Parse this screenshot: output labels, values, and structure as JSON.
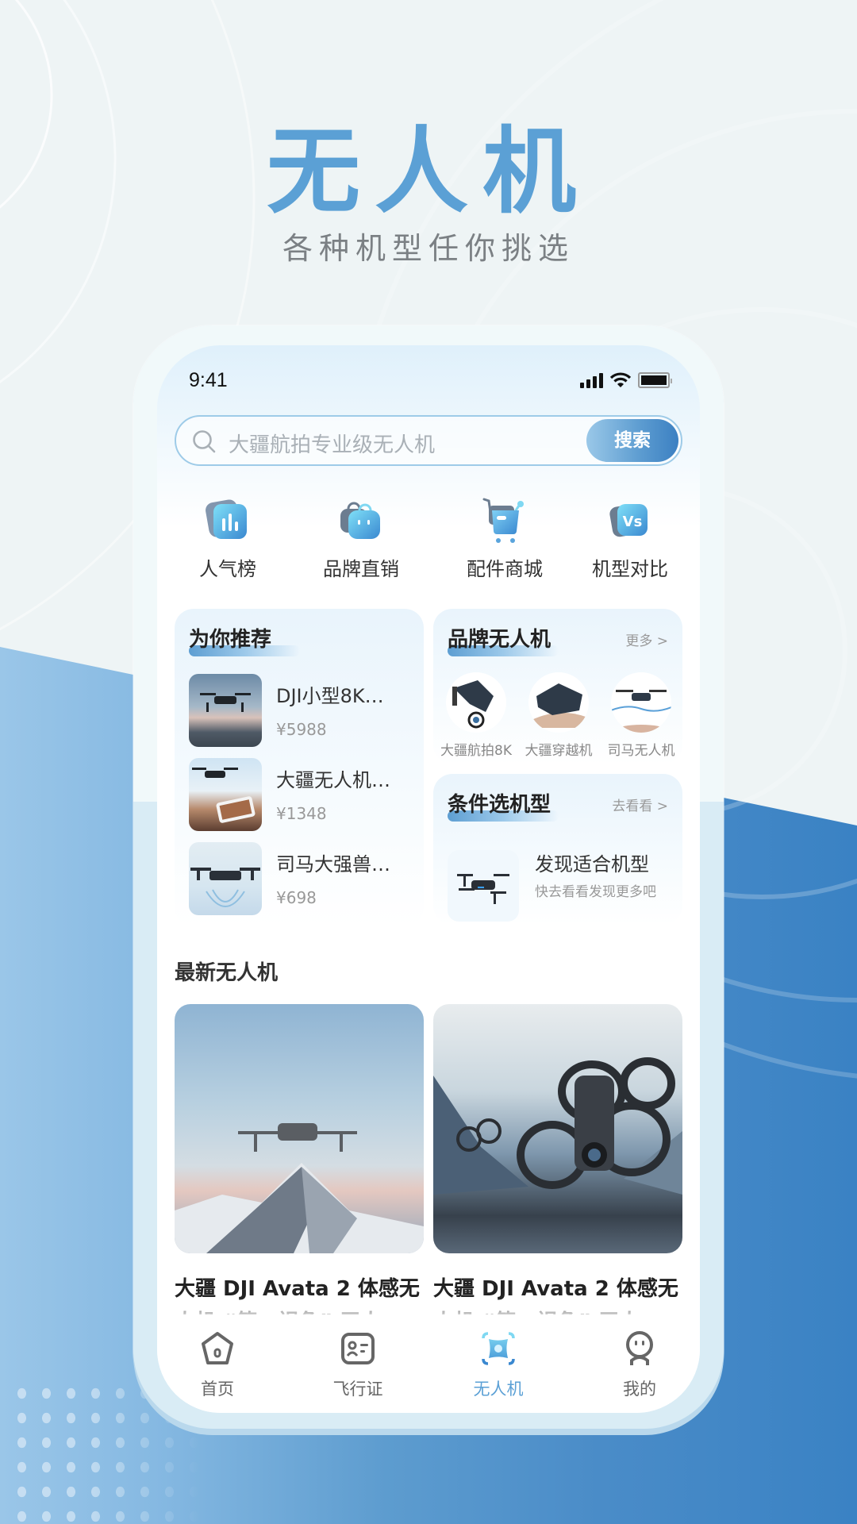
{
  "hero": {
    "title": "无人机",
    "subtitle": "各种机型任你挑选"
  },
  "status_bar": {
    "time": "9:41",
    "icons": [
      "signal-icon",
      "wifi-icon",
      "battery-icon"
    ]
  },
  "search": {
    "placeholder": "大疆航拍专业级无人机",
    "button_label": "搜索"
  },
  "categories": [
    {
      "label": "人气榜",
      "icon": "chart-icon"
    },
    {
      "label": "品牌直销",
      "icon": "shopping-bag-icon"
    },
    {
      "label": "配件商城",
      "icon": "cart-icon"
    },
    {
      "label": "机型对比",
      "icon": "vs-icon"
    }
  ],
  "recommend": {
    "title": "为你推荐",
    "items": [
      {
        "name": "DJI小型8K…",
        "price": "¥5988"
      },
      {
        "name": "大疆无人机…",
        "price": "¥1348"
      },
      {
        "name": "司马大强兽…",
        "price": "¥698"
      }
    ]
  },
  "brand": {
    "title": "品牌无人机",
    "more": "更多 >",
    "items": [
      {
        "label": "大疆航拍8K"
      },
      {
        "label": "大疆穿越机"
      },
      {
        "label": "司马无人机"
      }
    ]
  },
  "filter": {
    "title": "条件选机型",
    "more": "去看看 >",
    "headline": "发现适合机型",
    "desc": "快去看看发现更多吧"
  },
  "latest": {
    "title": "最新无人机",
    "items": [
      {
        "name": "大疆 DJI Avata 2 体感无",
        "name_cont": "人机 “第一视角” 无人"
      },
      {
        "name": "大疆 DJI Avata 2 体感无",
        "name_cont": "人机 “第一视角” 无人"
      }
    ]
  },
  "tabbar": {
    "active_index": 2,
    "active_color": "#5ba0d5",
    "items": [
      {
        "label": "首页",
        "icon": "home-icon"
      },
      {
        "label": "飞行证",
        "icon": "id-card-icon"
      },
      {
        "label": "无人机",
        "icon": "drone-icon"
      },
      {
        "label": "我的",
        "icon": "profile-icon"
      }
    ]
  },
  "colors": {
    "accent": "#5ba0d5",
    "background_light": "#eef4f5",
    "background_blue": "#3a82c4"
  }
}
